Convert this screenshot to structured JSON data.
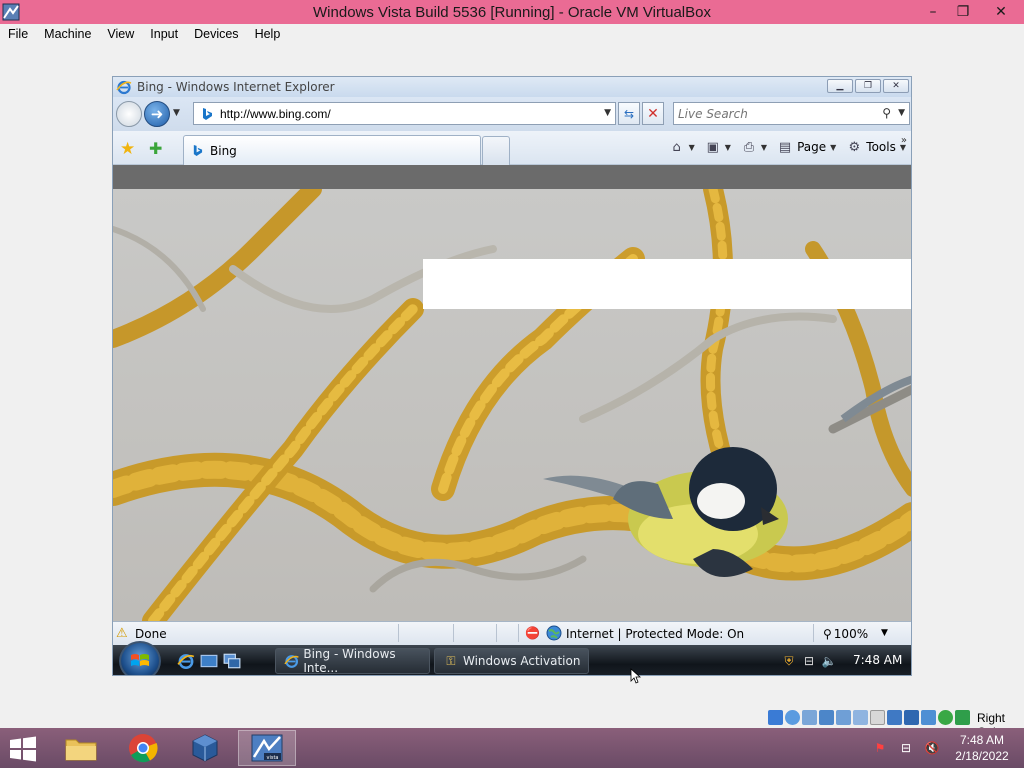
{
  "virtualbox": {
    "title": "Windows Vista Build 5536 [Running] - Oracle VM VirtualBox",
    "menu": [
      "File",
      "Machine",
      "View",
      "Input",
      "Devices",
      "Help"
    ],
    "host_key": "Right Ctrl"
  },
  "ie": {
    "title": "Bing - Windows Internet Explorer",
    "address": "http://www.bing.com/",
    "search_placeholder": "Live Search",
    "tab_label": "Bing",
    "page_label": "Page",
    "tools_label": "Tools",
    "status_text": "Done",
    "zone_text": "Internet | Protected Mode: On",
    "zoom": "100%"
  },
  "vista_taskbar": {
    "tasks": [
      "Bing - Windows Inte...",
      "Windows Activation"
    ],
    "clock": "7:48 AM"
  },
  "host_taskbar": {
    "time": "7:48 AM",
    "date": "2/18/2022"
  },
  "colors": {
    "vb_title_bg": "#ea6b94",
    "host_taskbar_bg": "#7a5570",
    "ie_chrome": "#dbe6f4",
    "lichen": "#d9a321"
  },
  "icons": {
    "ie_logo": "ie-logo-icon",
    "bing_logo": "bing-b-icon",
    "favorites": "star-icon",
    "add_favorites": "add-star-icon",
    "home": "home-icon",
    "feeds": "rss-icon",
    "print": "printer-icon",
    "warning": "warning-icon",
    "globe": "globe-icon"
  }
}
